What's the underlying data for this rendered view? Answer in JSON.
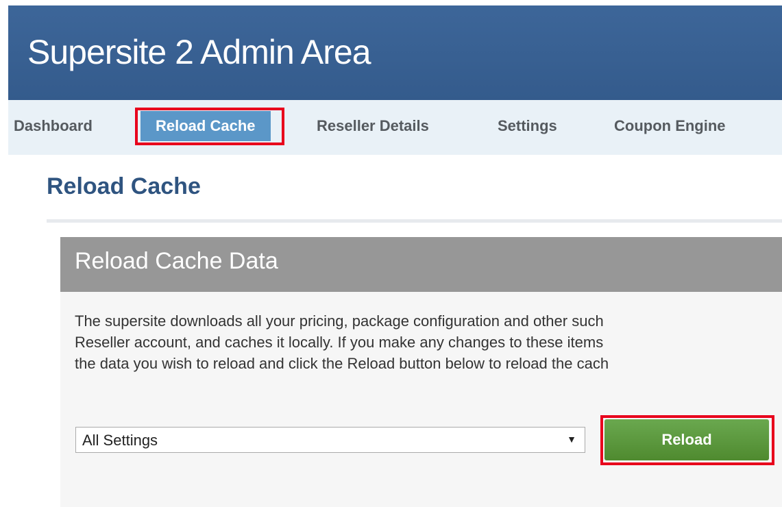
{
  "header": {
    "title": "Supersite 2 Admin Area"
  },
  "nav": {
    "items": [
      {
        "label": "Dashboard"
      },
      {
        "label": "Reload Cache",
        "active": true
      },
      {
        "label": "Reseller Details"
      },
      {
        "label": "Settings"
      },
      {
        "label": "Coupon Engine"
      }
    ]
  },
  "page": {
    "title": "Reload Cache"
  },
  "panel": {
    "title": "Reload Cache Data",
    "text_lines": [
      "The supersite downloads all your pricing, package configuration and other such",
      "Reseller account, and caches it locally. If you make any changes to these items",
      "the data you wish to reload and click the Reload button below to reload the cach"
    ],
    "select": {
      "value": "All Settings",
      "arrow": "▼"
    },
    "reload_button": "Reload"
  },
  "colors": {
    "header_bg": "#3d6699",
    "nav_bg": "#e9f1f7",
    "nav_active_bg": "#5b97c8",
    "highlight_red": "#e8001c",
    "page_title": "#2f5480",
    "panel_header_bg": "#979797",
    "panel_bg": "#f6f6f6",
    "button_green": "#5d9a3f"
  }
}
